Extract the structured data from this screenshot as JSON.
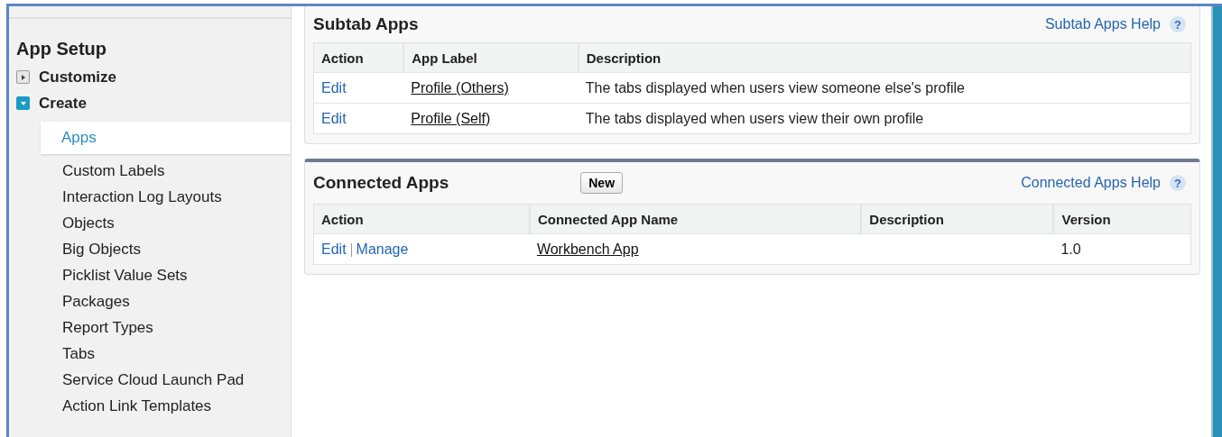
{
  "sidebar": {
    "title": "App Setup",
    "sections": [
      {
        "label": "Customize",
        "expanded": false
      },
      {
        "label": "Create",
        "expanded": true,
        "children": [
          {
            "label": "Apps",
            "selected": true
          },
          {
            "label": "Custom Labels",
            "selected": false
          },
          {
            "label": "Interaction Log Layouts",
            "selected": false
          },
          {
            "label": "Objects",
            "selected": false
          },
          {
            "label": "Big Objects",
            "selected": false
          },
          {
            "label": "Picklist Value Sets",
            "selected": false
          },
          {
            "label": "Packages",
            "selected": false
          },
          {
            "label": "Report Types",
            "selected": false
          },
          {
            "label": "Tabs",
            "selected": false
          },
          {
            "label": "Service Cloud Launch Pad",
            "selected": false
          },
          {
            "label": "Action Link Templates",
            "selected": false
          }
        ]
      }
    ]
  },
  "panels": [
    {
      "title": "Subtab Apps",
      "help_link": "Subtab Apps Help",
      "help_icon": "?",
      "table": {
        "columns": [
          "Action",
          "App Label",
          "Description"
        ],
        "rows": [
          {
            "actions": [
              "Edit"
            ],
            "name": "Profile (Others)",
            "description": "The tabs displayed when users view someone else's profile"
          },
          {
            "actions": [
              "Edit"
            ],
            "name": "Profile (Self)",
            "description": "The tabs displayed when users view their own profile"
          }
        ]
      }
    },
    {
      "title": "Connected Apps",
      "button": "New",
      "help_link": "Connected Apps Help",
      "help_icon": "?",
      "table": {
        "columns": [
          "Action",
          "Connected App Name",
          "Description",
          "Version"
        ],
        "rows": [
          {
            "actions": [
              "Edit",
              "Manage"
            ],
            "name": "Workbench App",
            "version": "1.0"
          }
        ]
      }
    }
  ]
}
